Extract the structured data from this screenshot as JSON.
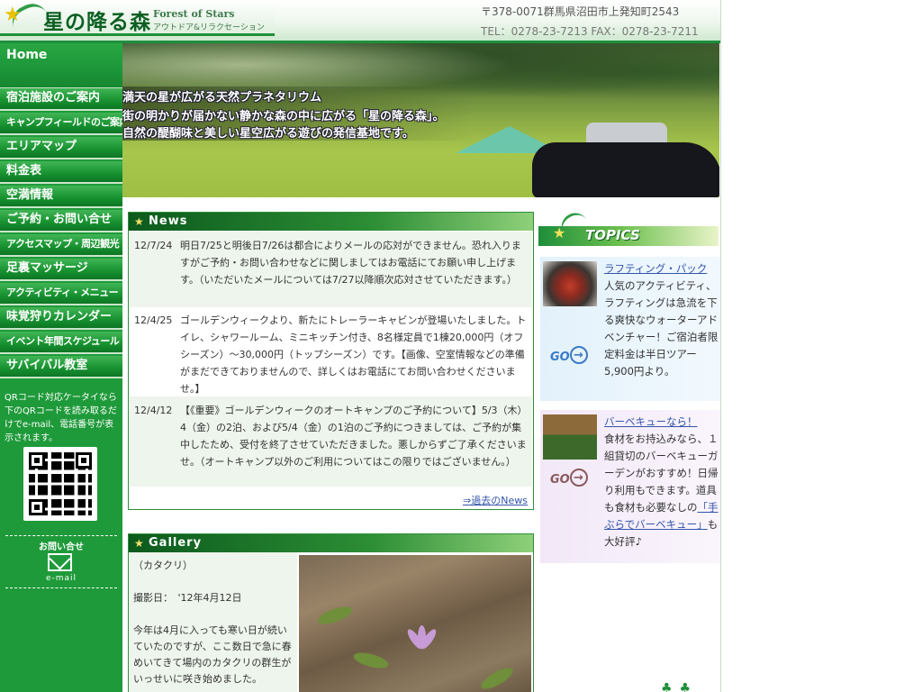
{
  "header": {
    "logo_jp": "星の降る森",
    "logo_en": "Forest of Stars",
    "logo_sub": "アウトドア&リラクセーション",
    "address": "〒378-0071群馬県沼田市上発知町2543",
    "tel_fax": "TEL：0278-23-7213 FAX：0278-23-7211"
  },
  "sidebar": {
    "home": "Home",
    "items": [
      {
        "label": "宿泊施設のご案内"
      },
      {
        "label": "キャンプフィールドのご案内"
      },
      {
        "label": "エリアマップ"
      },
      {
        "label": "料金表"
      },
      {
        "label": "空満情報"
      },
      {
        "label": "ご予約・お問い合せ"
      },
      {
        "label": "アクセスマップ・周辺観光"
      },
      {
        "label": "足裏マッサージ"
      },
      {
        "label": "アクティビティ・メニュー"
      },
      {
        "label": "味覚狩りカレンダー"
      },
      {
        "label": "イベント年間スケジュール"
      },
      {
        "label": "サバイバル教室"
      }
    ],
    "qr_text": "QRコード対応ケータイなら下のQRコードを読み取るだけでe-mail、電話番号が表示されます。",
    "contact_title": "お問い合せ",
    "email_label": "e-mail"
  },
  "hero": {
    "lines": [
      "満天の星が広がる天然プラネタリウム",
      "街の明かりが届かない静かな森の中に広がる「星の降る森」。",
      "自然の醍醐味と美しい星空広がる遊びの発信基地です。"
    ]
  },
  "news": {
    "title": "News",
    "items": [
      {
        "date": "12/7/24",
        "text": "明日7/25と明後日7/26は都合によりメールの応対ができません。恐れ入りますがご予約・お問い合わせなどに関しましてはお電話にてお願い申し上げます。（いただいたメールについては7/27以降順次応対させていただきます。）"
      },
      {
        "date": "12/4/25",
        "text": "ゴールデンウィークより、新たにトレーラーキャビンが登場いたしました。トイレ、シャワールーム、ミニキッチン付き、8名様定員で1棟20,000円（オフシーズン）～30,000円（トップシーズン）です。【画像、空室情報などの準備がまだできておりませんので、詳しくはお電話にてお問い合わせくださいませ。】"
      },
      {
        "date": "12/4/12",
        "text": "【《重要》ゴールデンウィークのオートキャンプのご予約について】5/3（木）4（金）の2泊、および5/4（金）の1泊のご予約につきましては、ご予約が集中したため、受付を終了させていただきました。悪しからずご了承くださいませ。（オートキャンプ以外のご利用についてはこの限りではございません。）"
      }
    ],
    "more": "⇒過去のNews"
  },
  "gallery": {
    "title": "Gallery",
    "caption": "（カタクリ）",
    "shot_date": "撮影日：　'12年4月12日",
    "body": "今年は4月に入っても寒い日が続いていたのですが、ここ数日で急に春めいてきて場内のカタクリの群生がいっせいに咲き始めました。"
  },
  "topics": {
    "title": "TOPICS",
    "go_label": "GO",
    "items": [
      {
        "title": "ラフティング・パック",
        "body": "人気のアクティビティ、ラフティングは急流を下る爽快なウォーターアドベンチャー！ご宿泊者限定料金は半日ツアー5,900円より。"
      },
      {
        "title": "バーベキューなら！",
        "body_pre": "食材をお持込みなら、１組貸切のバーベキューガーデンがおすすめ！日帰り利用もできます。道具も食材も必要なしの",
        "link": "「手ぶらでバーベキュー」",
        "body_post": "も大好評♪"
      }
    ]
  },
  "colors": {
    "nav_green": "#1f9a3a",
    "frame_green": "#2f8f3a",
    "link_blue": "#3355aa"
  }
}
